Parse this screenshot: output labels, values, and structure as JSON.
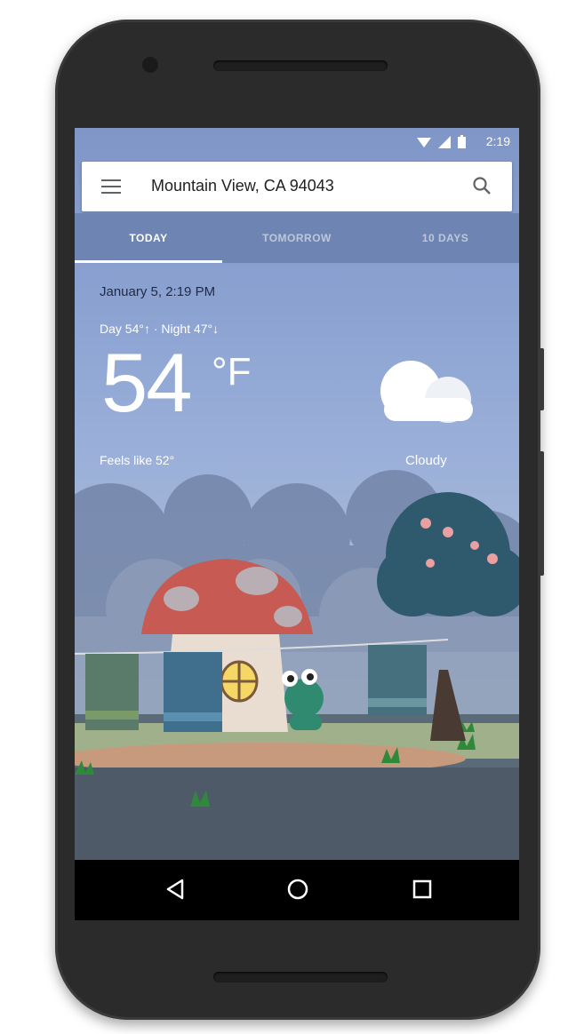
{
  "status_bar": {
    "time": "2:19"
  },
  "search": {
    "location": "Mountain View, CA 94043"
  },
  "tabs": [
    {
      "label": "TODAY"
    },
    {
      "label": "TOMORROW"
    },
    {
      "label": "10 DAYS"
    }
  ],
  "weather": {
    "date": "January 5, 2:19 PM",
    "day_night": "Day 54°↑ · Night 47°↓",
    "temperature": "54",
    "unit": "°F",
    "feels_like": "Feels like 52°",
    "condition": "Cloudy",
    "condition_icon": "cloud-icon"
  },
  "nav_bar": {
    "icons": [
      "back-icon",
      "home-icon",
      "recents-icon"
    ]
  },
  "colors": {
    "sky": "#8ca3d2",
    "tab_bar": "#6e84b2",
    "mushroom_cap": "#c75a52"
  }
}
